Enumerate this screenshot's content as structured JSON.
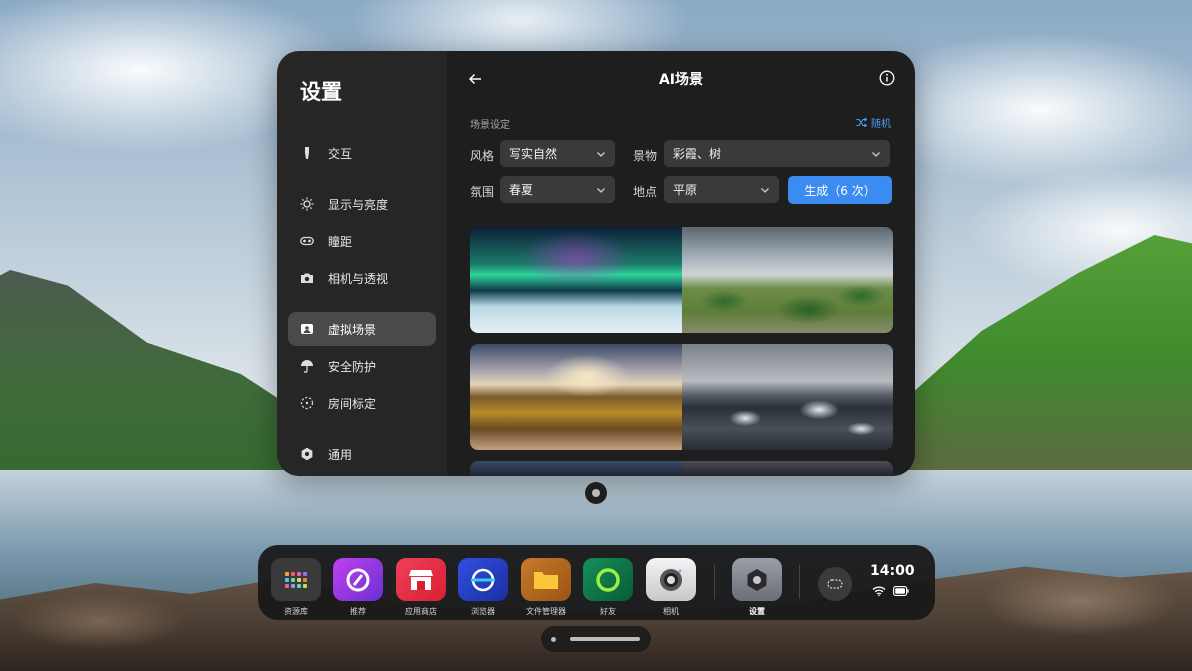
{
  "settings": {
    "title": "设置",
    "items": [
      {
        "label": "交互",
        "icon": "controller-icon"
      },
      {
        "label": "显示与亮度",
        "icon": "brightness-icon"
      },
      {
        "label": "瞳距",
        "icon": "ipd-icon"
      },
      {
        "label": "相机与透视",
        "icon": "camera-icon"
      },
      {
        "label": "虚拟场景",
        "icon": "scene-icon",
        "active": true
      },
      {
        "label": "安全防护",
        "icon": "umbrella-icon"
      },
      {
        "label": "房间标定",
        "icon": "room-calibration-icon"
      },
      {
        "label": "通用",
        "icon": "gear-icon"
      }
    ]
  },
  "ai_scene": {
    "title": "AI场景",
    "section_label": "场景设定",
    "random_label": "随机",
    "fields": {
      "style": {
        "label": "风格",
        "value": "写实自然"
      },
      "scenery": {
        "label": "景物",
        "value": "彩霞、树"
      },
      "mood": {
        "label": "氛围",
        "value": "春夏"
      },
      "place": {
        "label": "地点",
        "value": "平原"
      }
    },
    "generate_label": "生成（6 次）"
  },
  "dock": {
    "apps": [
      {
        "name": "资源库",
        "color": "#3a3a3a"
      },
      {
        "name": "推荐",
        "color": "#a040e0"
      },
      {
        "name": "应用商店",
        "color": "#e8303a"
      },
      {
        "name": "浏览器",
        "color": "#2a40c8"
      },
      {
        "name": "文件管理器",
        "color": "#b8681a"
      },
      {
        "name": "好友",
        "color": "#0f7a4a"
      },
      {
        "name": "相机",
        "color": "#d8d8d8"
      },
      {
        "name": "设置",
        "color": "#7a7e86"
      }
    ],
    "time": "14:00"
  }
}
